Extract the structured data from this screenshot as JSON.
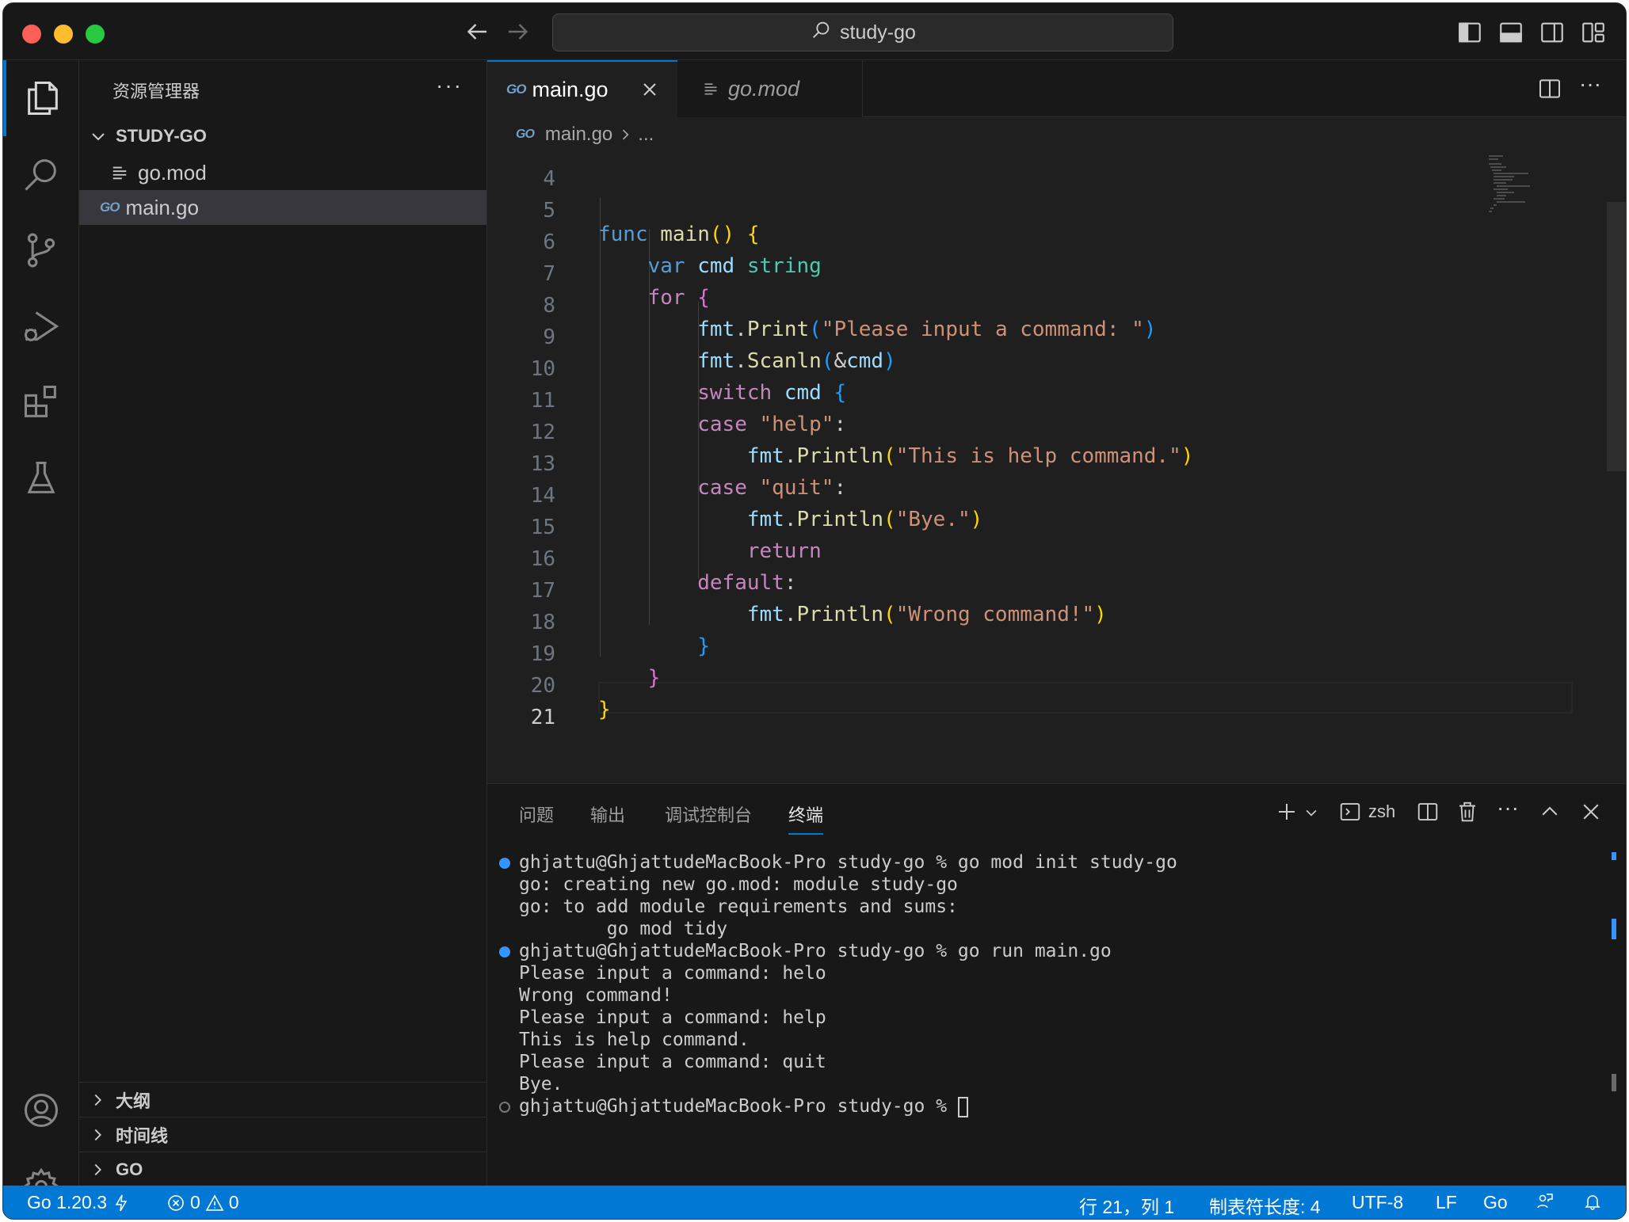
{
  "titlebar": {
    "search_text": "study-go"
  },
  "activity_bar": {
    "items": [
      "explorer-icon",
      "search-icon",
      "source-control-icon",
      "run-debug-icon",
      "extensions-icon",
      "testing-icon"
    ],
    "bottom": [
      "accounts-icon",
      "settings-gear-icon"
    ],
    "accent": "#0078d4"
  },
  "sidebar": {
    "title": "资源管理器",
    "more": "···",
    "folder": "STUDY-GO",
    "files": [
      {
        "name": "go.mod",
        "icon": "lines-icon"
      },
      {
        "name": "main.go",
        "icon": "GO"
      }
    ],
    "sections": [
      "大纲",
      "时间线",
      "GO"
    ]
  },
  "editor": {
    "tabs": [
      {
        "label": "main.go",
        "icon": "GO",
        "active": true
      },
      {
        "label": "go.mod",
        "icon": "lines-icon",
        "active": false
      }
    ],
    "breadcrumb": {
      "file": "main.go",
      "rest": "..."
    },
    "go_icon": "GO",
    "line_numbers": [
      "4",
      "5",
      "6",
      "7",
      "8",
      "9",
      "10",
      "11",
      "12",
      "13",
      "14",
      "15",
      "16",
      "17",
      "18",
      "19",
      "20",
      "21"
    ],
    "current_line": "21"
  },
  "panel": {
    "tabs": [
      "问题",
      "输出",
      "调试控制台",
      "终端"
    ],
    "active_tab": "终端",
    "shell": "zsh",
    "terminal_lines": [
      "ghjattu@GhjattudeMacBook-Pro study-go % go mod init study-go",
      "go: creating new go.mod: module study-go",
      "go: to add module requirements and sums:",
      "        go mod tidy",
      "ghjattu@GhjattudeMacBook-Pro study-go % go run main.go",
      "Please input a command: helo",
      "Wrong command!",
      "Please input a command: help",
      "This is help command.",
      "Please input a command: quit",
      "Bye.",
      "ghjattu@GhjattudeMacBook-Pro study-go % "
    ]
  },
  "statusbar": {
    "go_version": "Go 1.20.3",
    "errors": "0",
    "warnings": "0",
    "position": "行 21，列 1",
    "tab_size": "制表符长度: 4",
    "encoding": "UTF-8",
    "eol": "LF",
    "language": "Go",
    "color": "#0078d4"
  }
}
